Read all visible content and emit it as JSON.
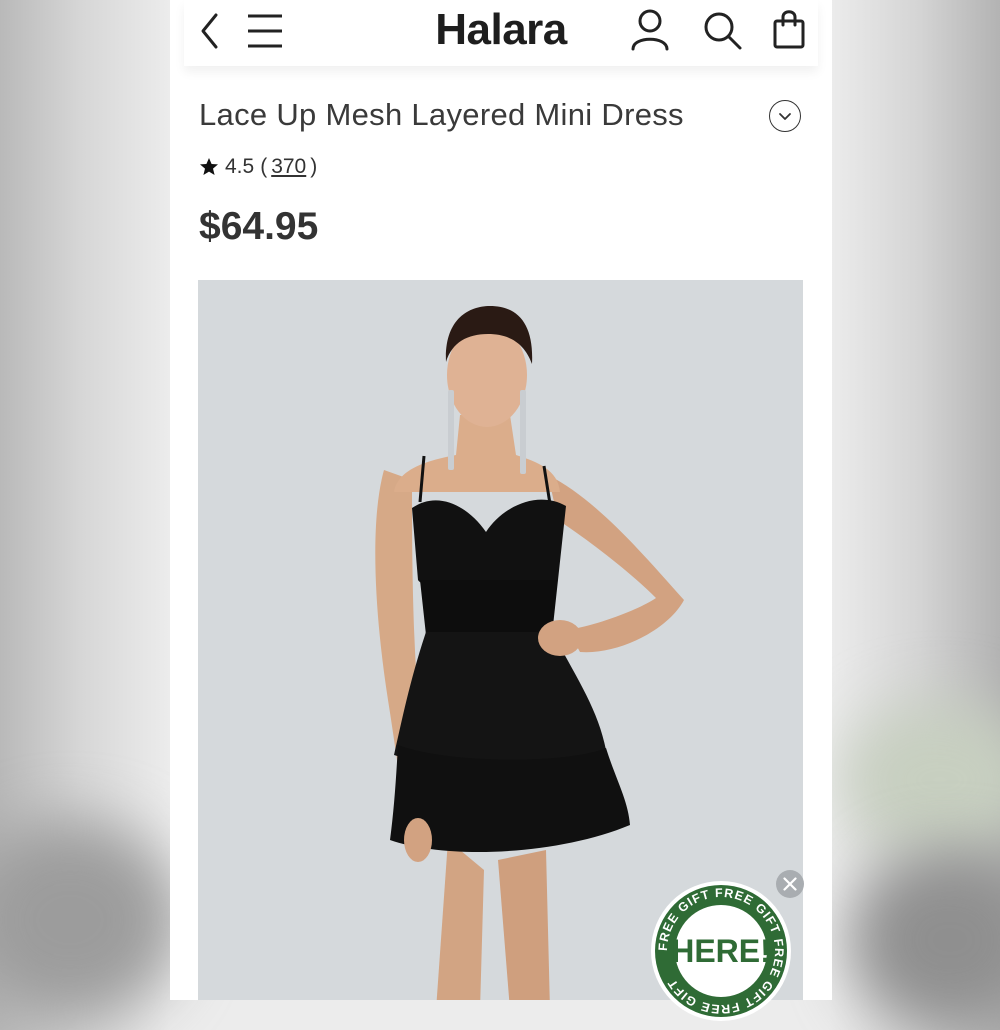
{
  "header": {
    "logo": "Halara",
    "icons": [
      "back-arrow-icon",
      "menu-icon",
      "user-icon",
      "search-icon",
      "shopping-bag-icon"
    ]
  },
  "product": {
    "title": "Lace Up Mesh Layered Mini Dress",
    "rating": "4.5",
    "review_open": "(",
    "review_count": "370",
    "review_close": ")",
    "price": "$64.95",
    "image_alt": "Model wearing black lace up mesh layered mini dress"
  },
  "promo": {
    "badge_main": "HERE!",
    "badge_ring": "FREE GIFT FREE GIFT FREE GIFT FREE GIFT",
    "badge_color": "#2f6b35"
  }
}
